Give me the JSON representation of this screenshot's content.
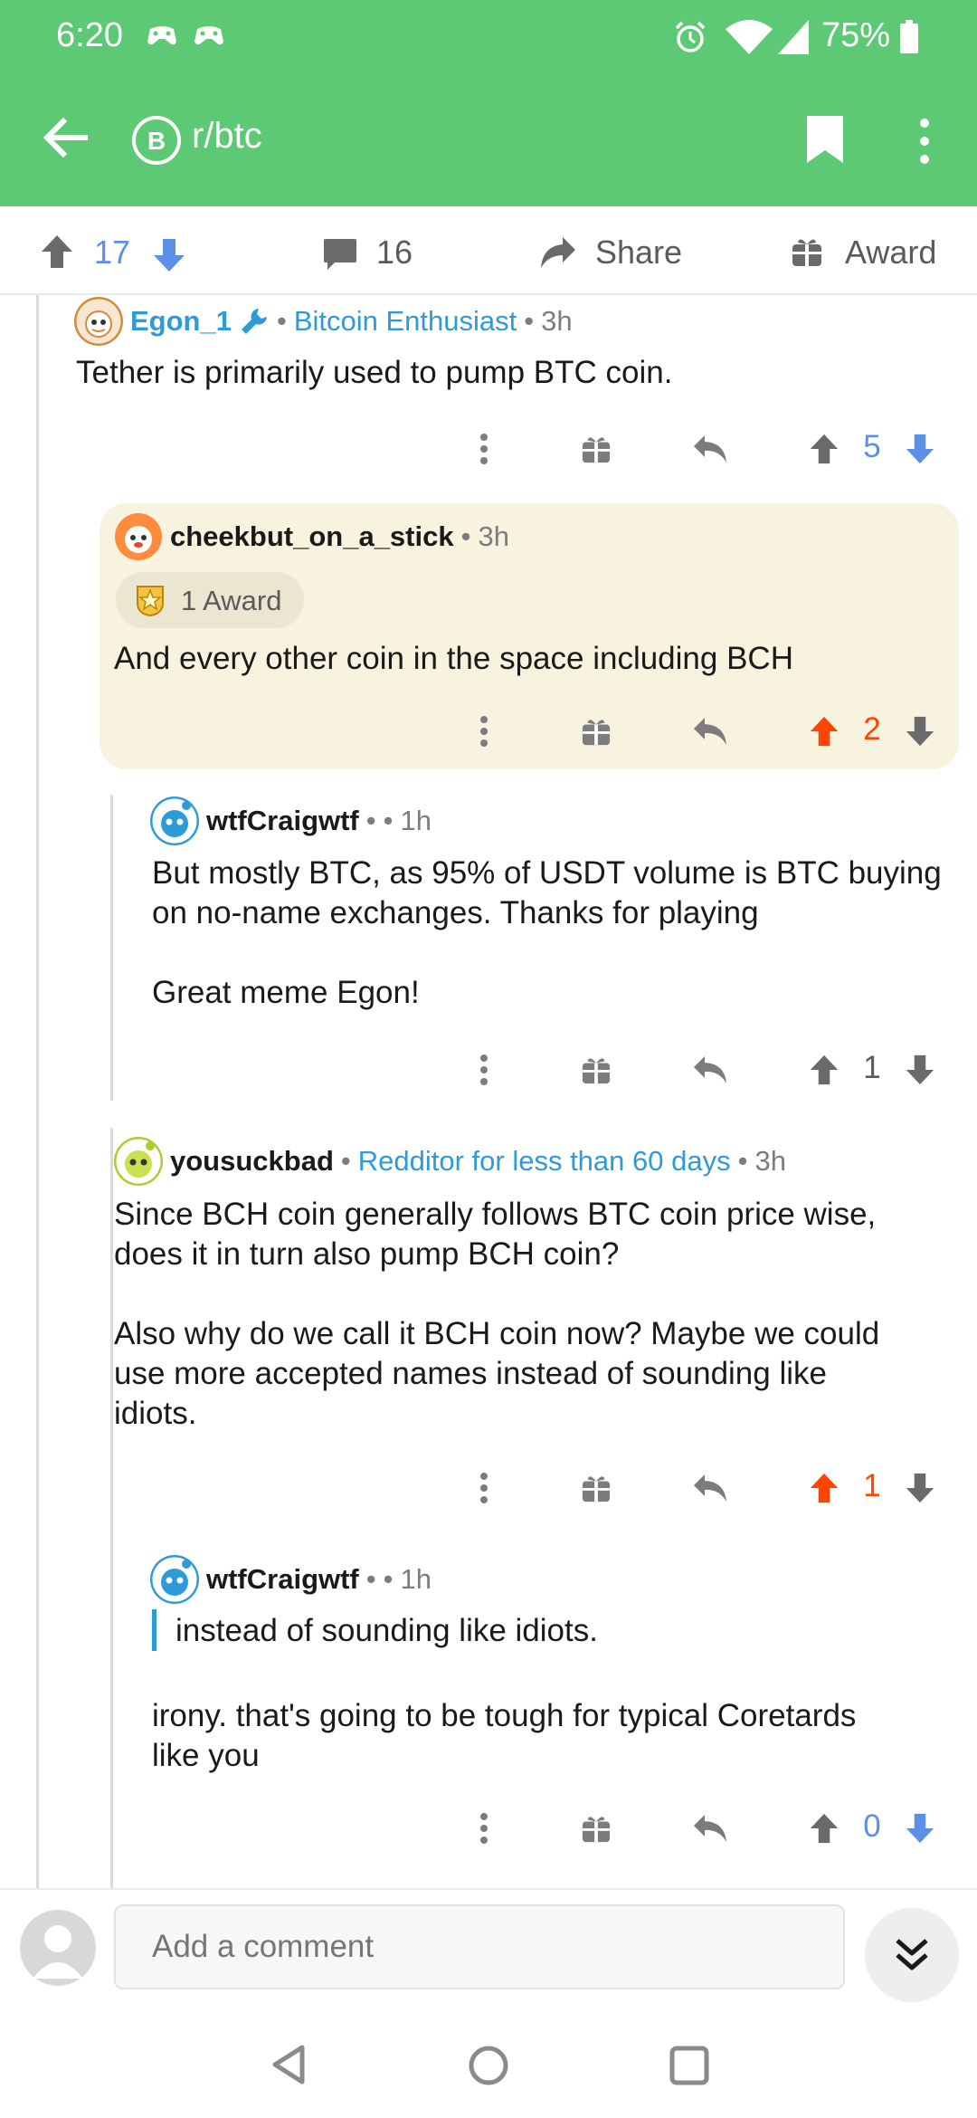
{
  "status_bar": {
    "time": "6:20",
    "battery": "75%"
  },
  "header": {
    "subreddit": "r/btc",
    "sub_icon_letter": "B"
  },
  "post_actions": {
    "score": "17",
    "comments": "16",
    "share_label": "Share",
    "award_label": "Award"
  },
  "comments": [
    {
      "username": "Egon_1",
      "flair": "Bitcoin Enthusiast",
      "time": "3h",
      "body": "Tether is primarily used to pump BTC coin.",
      "score": "5",
      "vote": "none"
    },
    {
      "username": "cheekbut_on_a_stick",
      "time": "3h",
      "awards": "1 Award",
      "body": "And every other coin in the space including BCH",
      "score": "2",
      "vote": "up"
    },
    {
      "username": "wtfCraigwtf",
      "separator": "•",
      "time": "1h",
      "body": "But mostly BTC, as 95% of USDT volume is BTC buying\non no-name exchanges. Thanks for playing\n\nGreat meme Egon!",
      "score": "1",
      "vote": "none"
    },
    {
      "username": "yousuckbad",
      "flair": "Redditor for less than 60 days",
      "time": "3h",
      "body": "Since BCH coin generally follows BTC coin price wise,\ndoes it in turn also pump BCH coin?\n\nAlso why do we call it BCH coin now? Maybe we could\nuse more accepted names instead of sounding like\nidiots.",
      "score": "1",
      "vote": "up"
    },
    {
      "username": "wtfCraigwtf",
      "separator": "•",
      "time": "1h",
      "quote": "instead of sounding like idiots.",
      "body": "irony. that's going to be tough for typical Coretards\nlike you",
      "score": "0",
      "vote": "none"
    }
  ],
  "compose": {
    "placeholder": "Add a comment"
  },
  "colors": {
    "header_green": "#5ec974",
    "upvote_orange": "#ff4500",
    "downvote_blue": "#5c8fe6",
    "flair_blue": "#2d9bd8",
    "highlight_bg": "#f7f3de"
  }
}
